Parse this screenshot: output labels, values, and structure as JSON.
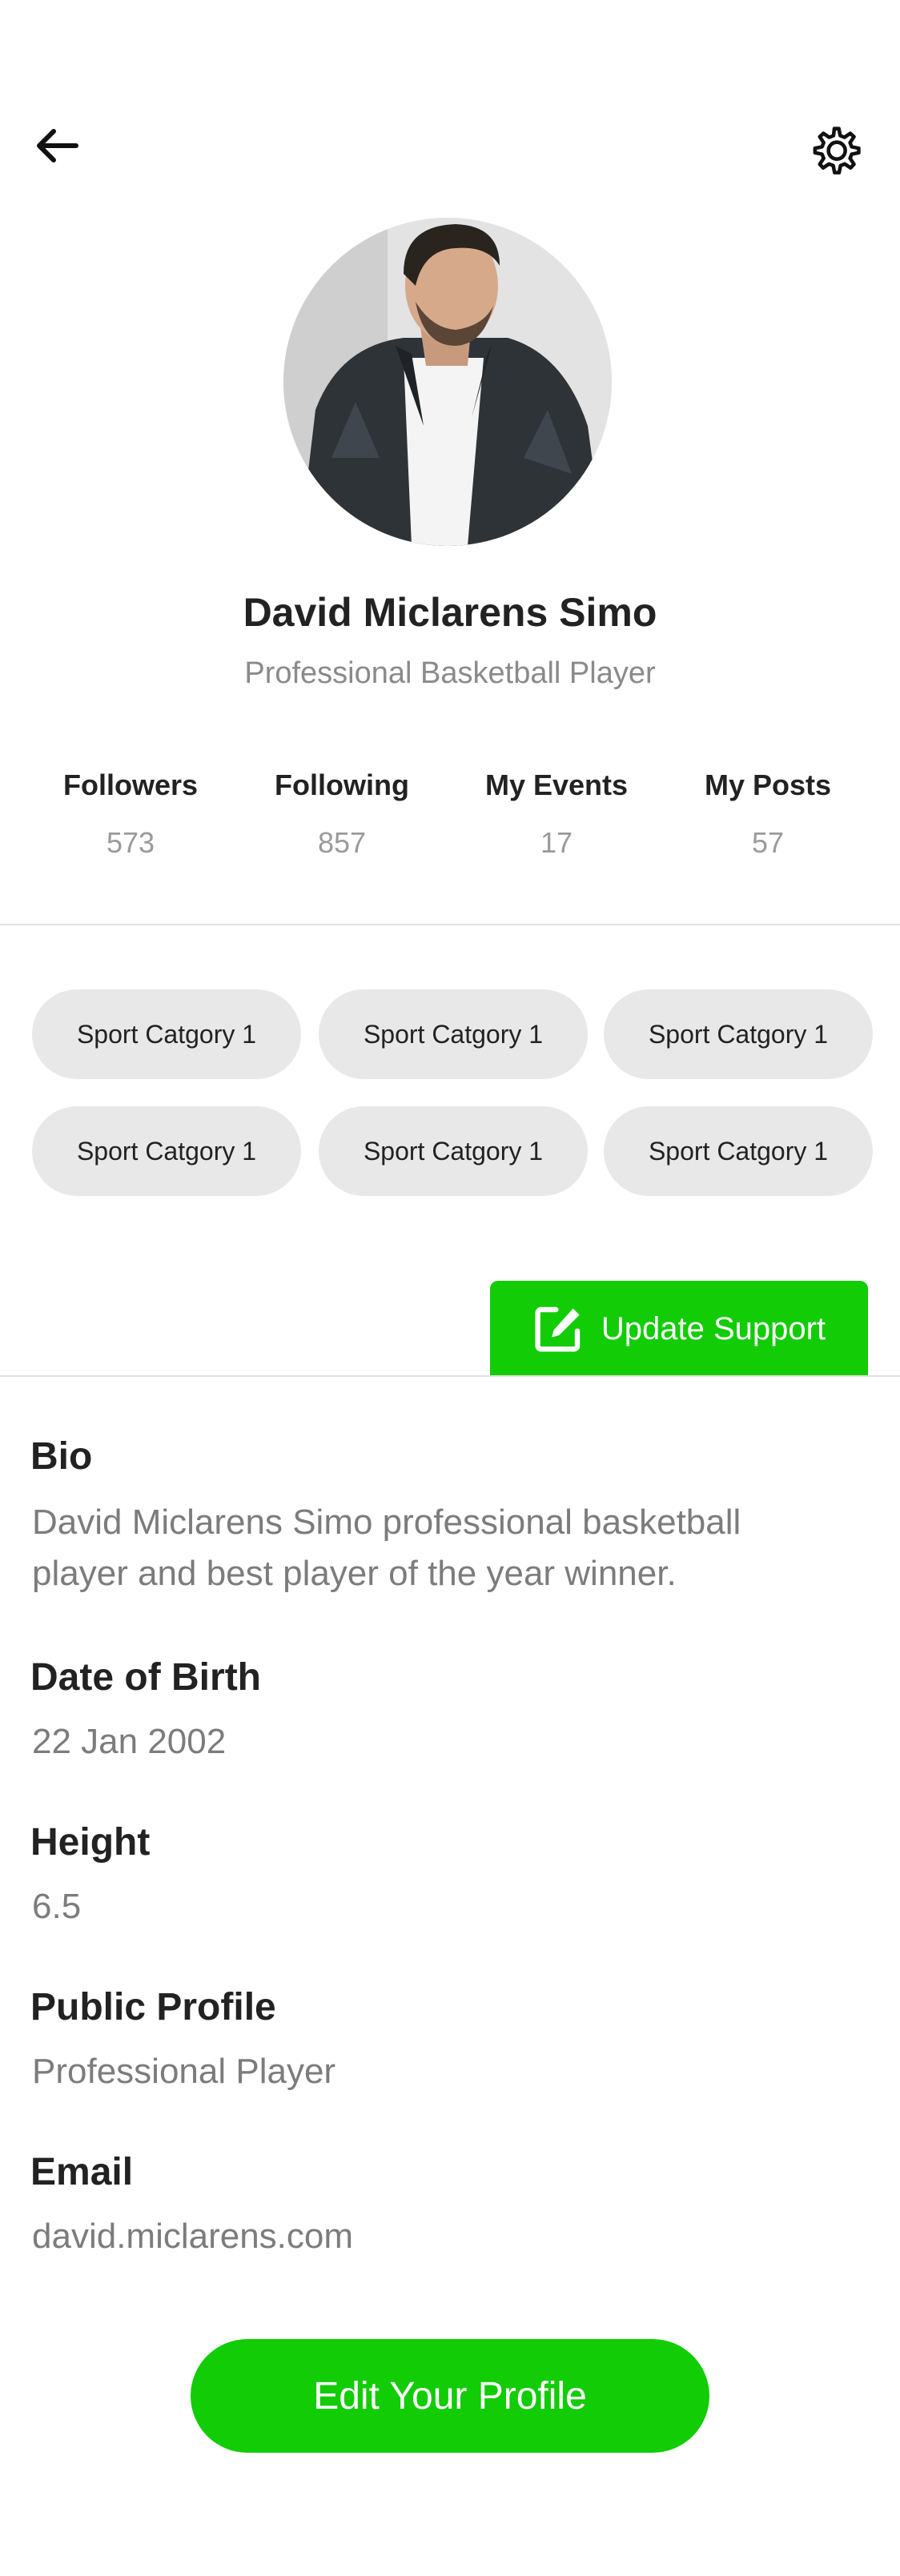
{
  "header": {
    "back_icon": "arrow-left-icon",
    "settings_icon": "gear-icon"
  },
  "profile": {
    "name": "David Miclarens Simo",
    "role": "Professional Basketball Player"
  },
  "stats": [
    {
      "label": "Followers",
      "value": "573"
    },
    {
      "label": "Following",
      "value": "857"
    },
    {
      "label": "My Events",
      "value": "17"
    },
    {
      "label": "My Posts",
      "value": "57"
    }
  ],
  "categories": [
    "Sport Catgory 1",
    "Sport Catgory 1",
    "Sport Catgory 1",
    "Sport Catgory 1",
    "Sport Catgory 1",
    "Sport Catgory 1"
  ],
  "update_support": {
    "label": "Update Support",
    "icon": "edit-icon"
  },
  "details": {
    "bio_label": "Bio",
    "bio_line1": "David Miclarens Simo professional basketball",
    "bio_line2": "player and best player of the year winner.",
    "dob_label": "Date of Birth",
    "dob_value": "22 Jan 2002",
    "height_label": "Height",
    "height_value": "6.5",
    "public_label": "Public Profile",
    "public_value": "Professional Player",
    "email_label": "Email",
    "email_value": "david.miclarens.com"
  },
  "edit_profile_label": "Edit Your Profile",
  "colors": {
    "accent": "#12cc06",
    "chip": "#e8e8e8",
    "muted": "#8a8a8a"
  }
}
